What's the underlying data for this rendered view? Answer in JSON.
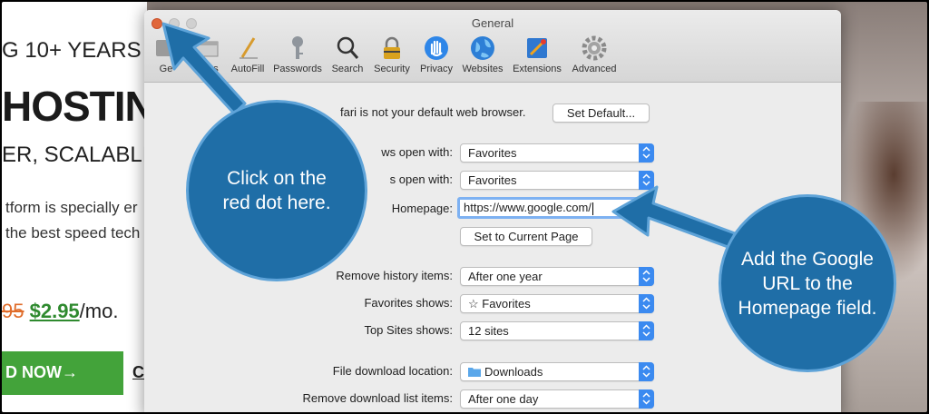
{
  "background_page": {
    "tagline": "G 10+ YEARS O",
    "headline": "HOSTIN",
    "subhead": "ER, SCALABLI",
    "body_line_1": "tform is specially er",
    "body_line_2": "the best speed tech",
    "old_price": "95",
    "new_price": "$2.95",
    "price_suffix": "/mo.",
    "cta_label": "D NOW→",
    "cta_secondary": "C"
  },
  "window": {
    "title": "General",
    "toolbar": [
      {
        "label": "General",
        "icon": "general-icon"
      },
      {
        "label": "Tabs",
        "icon": "tabs-icon"
      },
      {
        "label": "AutoFill",
        "icon": "autofill-pencil-icon"
      },
      {
        "label": "Passwords",
        "icon": "key-icon"
      },
      {
        "label": "Search",
        "icon": "magnifier-icon"
      },
      {
        "label": "Security",
        "icon": "lock-icon"
      },
      {
        "label": "Privacy",
        "icon": "hand-icon"
      },
      {
        "label": "Websites",
        "icon": "globe-icon"
      },
      {
        "label": "Extensions",
        "icon": "puzzle-icon"
      },
      {
        "label": "Advanced",
        "icon": "gear-icon"
      }
    ],
    "toolbar_general_visible": "Ge",
    "toolbar_tabs_visible": "bs"
  },
  "settings": {
    "default_browser_text": "fari is not your default web browser.",
    "set_default_button": "Set Default...",
    "new_windows_label": "ws open with:",
    "new_windows_value": "Favorites",
    "new_tabs_label": "s open with:",
    "new_tabs_value": "Favorites",
    "homepage_label": "Homepage:",
    "homepage_value": "https://www.google.com/",
    "set_current_page_button": "Set to Current Page",
    "remove_history_label": "Remove history items:",
    "remove_history_value": "After one year",
    "favorites_shows_label": "Favorites shows:",
    "favorites_shows_value": "☆ Favorites",
    "top_sites_label": "Top Sites shows:",
    "top_sites_value": "12 sites",
    "download_location_label": "File download location:",
    "download_location_value": "Downloads",
    "remove_download_label": "Remove download list items:",
    "remove_download_value": "After one day"
  },
  "annotations": {
    "callout_1_line_1": "Click on the",
    "callout_1_line_2": "red dot here.",
    "callout_2_line_1": "Add the Google",
    "callout_2_line_2": "URL to the",
    "callout_2_line_3": "Homepage field."
  },
  "colors": {
    "close_dot": "#e0673b",
    "callout_fill": "#1f6ea7",
    "popup_accent": "#3b8af0",
    "cta_green": "#43a33a"
  }
}
